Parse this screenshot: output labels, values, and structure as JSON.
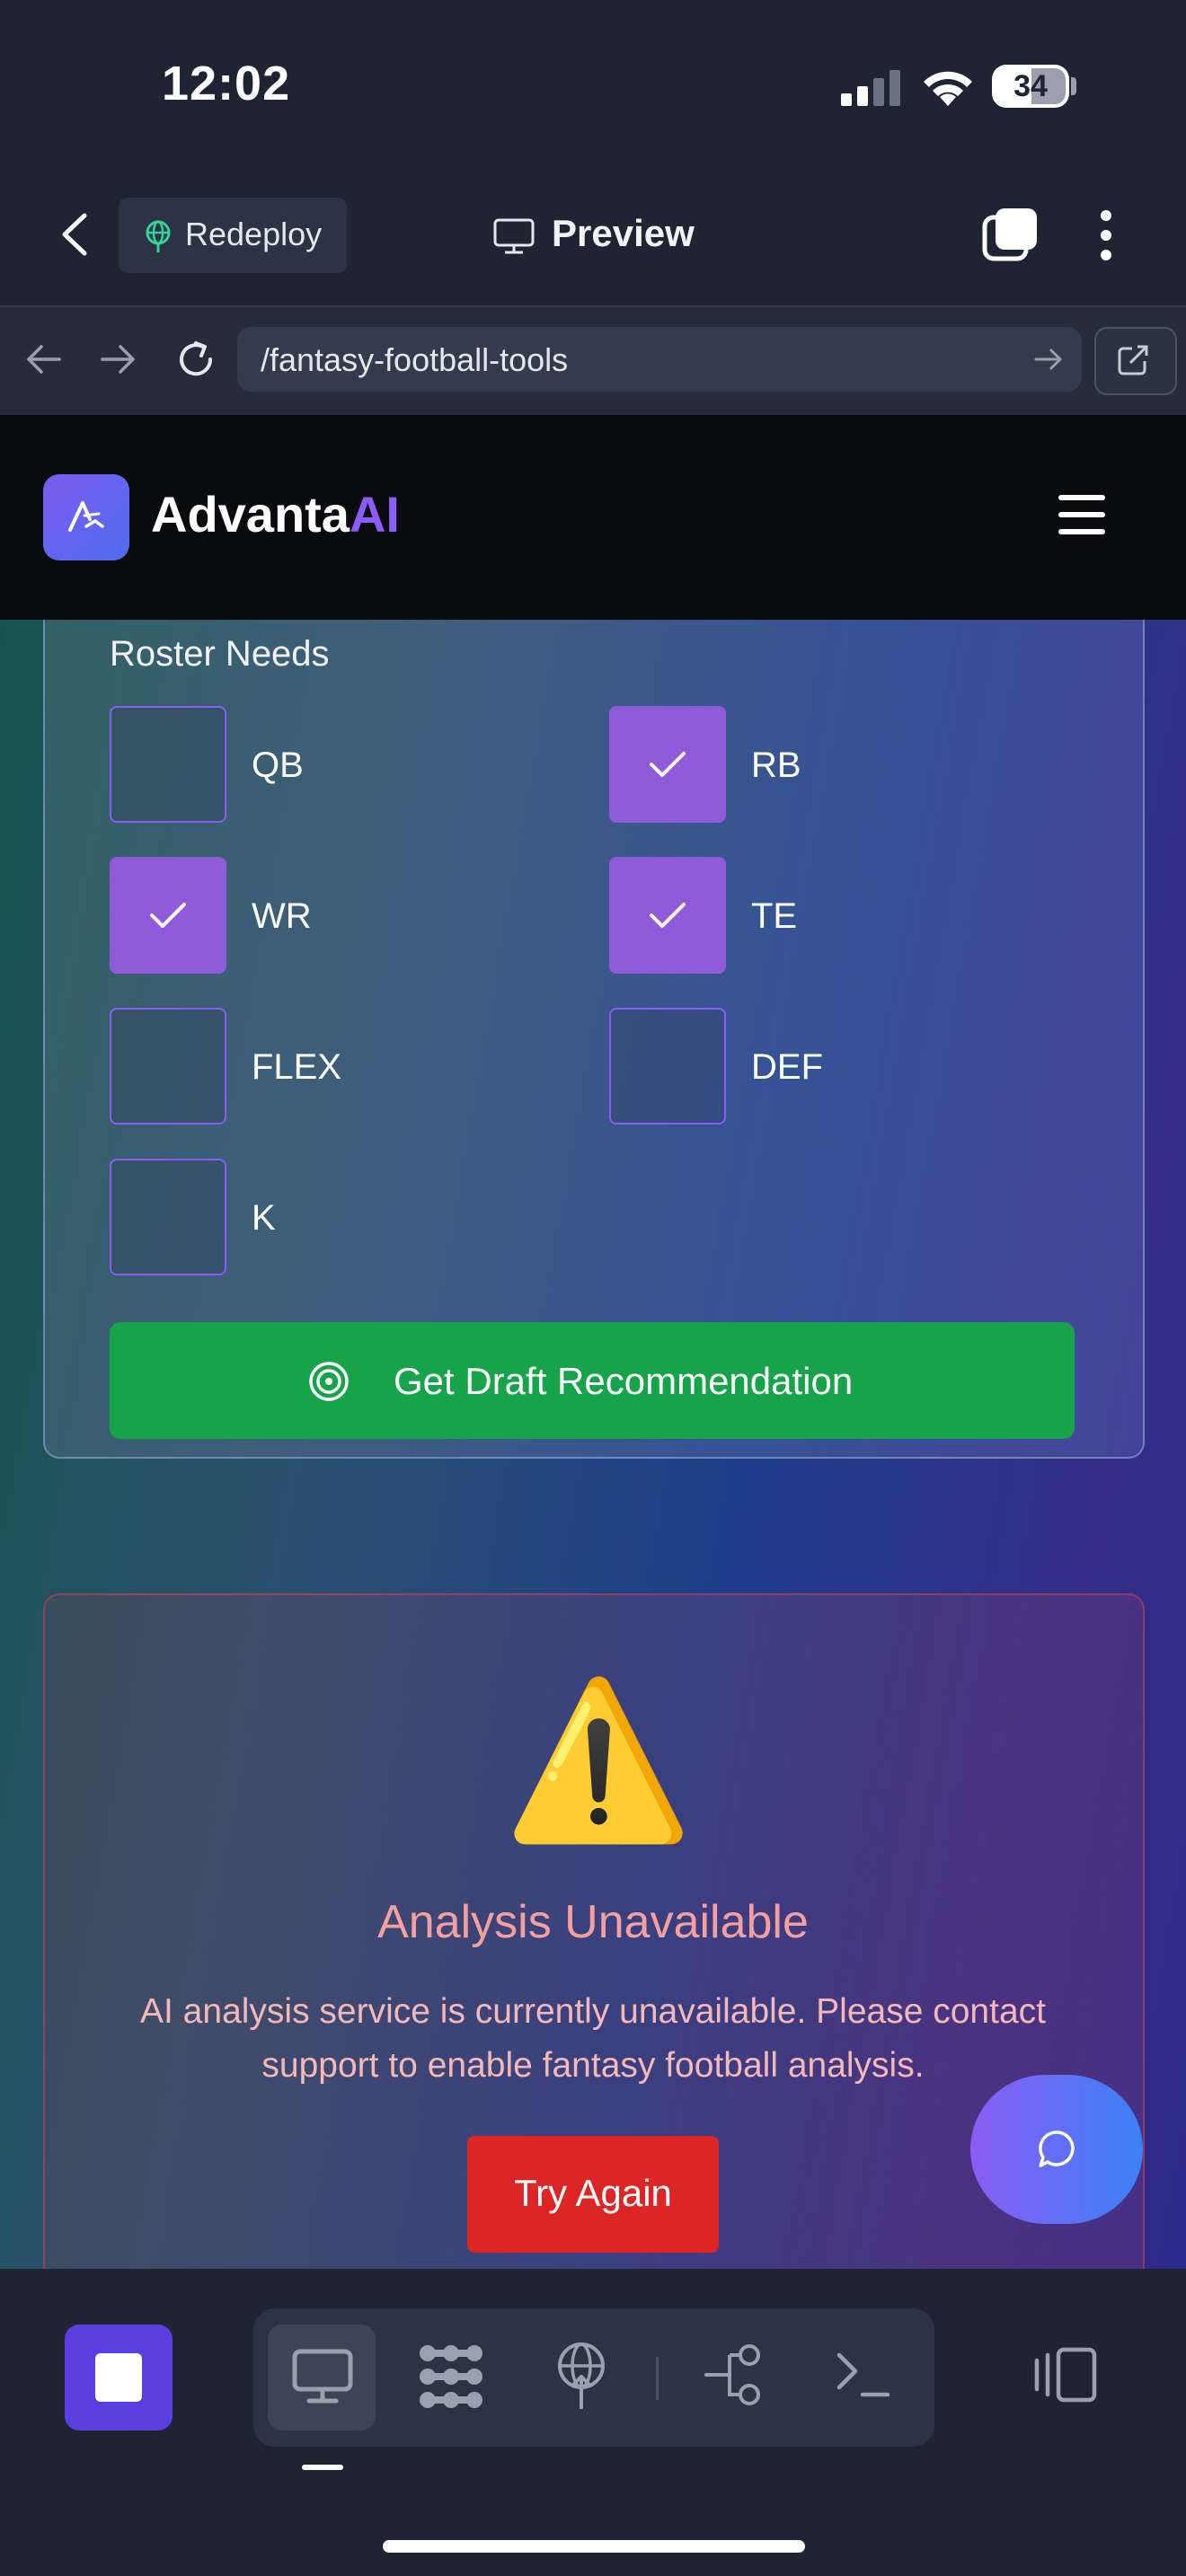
{
  "status_bar": {
    "time": "12:02",
    "battery": "34"
  },
  "app_header": {
    "redeploy_label": "Redeploy",
    "preview_label": "Preview"
  },
  "browser": {
    "url": "/fantasy-football-tools"
  },
  "site_nav": {
    "brand_main": "Advanta",
    "brand_accent": "AI"
  },
  "roster": {
    "label": "Roster Needs",
    "positions": [
      {
        "label": "QB",
        "checked": false
      },
      {
        "label": "RB",
        "checked": true
      },
      {
        "label": "WR",
        "checked": true
      },
      {
        "label": "TE",
        "checked": true
      },
      {
        "label": "FLEX",
        "checked": false
      },
      {
        "label": "DEF",
        "checked": false
      },
      {
        "label": "K",
        "checked": false
      }
    ],
    "submit_label": "Get Draft Recommendation"
  },
  "error": {
    "icon": "⚠️",
    "title": "Analysis Unavailable",
    "message": "AI analysis service is currently unavailable. Please contact support to enable fantasy football analysis.",
    "retry_label": "Try Again"
  },
  "colors": {
    "accent": "#8b5cf6",
    "primary_button": "#16a34a",
    "danger_button": "#dc2626",
    "error_text": "#f4a0a0"
  }
}
